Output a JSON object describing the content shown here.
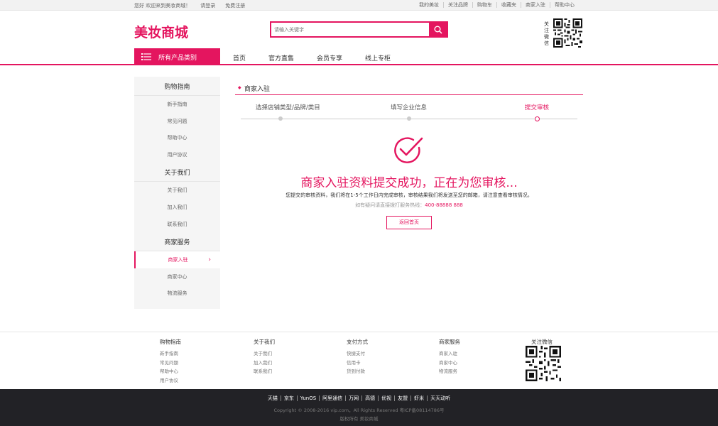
{
  "topbar": {
    "welcome": "您好 欢迎来到美妆商城！",
    "login": "请登录",
    "register": "免费注册",
    "links": [
      "我的美妆",
      "关注品牌",
      "购物车",
      "收藏夹",
      "商家入驻",
      "帮助中心"
    ]
  },
  "header": {
    "logo": "美妆商城",
    "search_placeholder": "请输入关键字",
    "follow_wechat": "关注微信"
  },
  "nav": {
    "all_categories": "所有产品类别",
    "links": [
      "首页",
      "官方直售",
      "会员专享",
      "线上专柜"
    ]
  },
  "sidebar": {
    "sections": [
      {
        "title": "购物指南",
        "items": [
          "新手指南",
          "常见问题",
          "帮助中心",
          "用户协议"
        ]
      },
      {
        "title": "关于我们",
        "items": [
          "关于我们",
          "加入我们",
          "联系我们"
        ]
      },
      {
        "title": "商家服务",
        "items": [
          "商家入驻",
          "商家中心",
          "物流服务"
        ]
      }
    ],
    "active_item": "商家入驻"
  },
  "main": {
    "section_title": "商家入驻",
    "steps": [
      "选择店铺类型/品牌/类目",
      "填写企业信息",
      "提交审核"
    ],
    "current_step": 3,
    "success_title": "商家入驻资料提交成功，正在为您审核...",
    "success_desc": "您提交的审核资料，我们将在1-5个工作日内完成审核，审核结果我们将发送至您的邮箱，请注意查看审核情况。",
    "hotline_label": "如有疑问请直接拨打服务热线：",
    "hotline_number": "400-88888 888",
    "back_button": "返回首页"
  },
  "footer": {
    "columns": [
      {
        "title": "购物指南",
        "items": [
          "新手指南",
          "常见问题",
          "帮助中心",
          "用户协议"
        ]
      },
      {
        "title": "关于我们",
        "items": [
          "关于我们",
          "加入我们",
          "联系我们"
        ]
      },
      {
        "title": "支付方式",
        "items": [
          "快捷支付",
          "信用卡",
          "货到付款"
        ]
      },
      {
        "title": "商家服务",
        "items": [
          "商家入驻",
          "商家中心",
          "物流服务"
        ]
      }
    ],
    "qr_title": "关注微信",
    "partners": [
      "天猫",
      "京东",
      "YunOS",
      "阿里通信",
      "万网",
      "高德",
      "优视",
      "友盟",
      "虾米",
      "天天动听"
    ],
    "copyright": "Copyright © 2008-2016 vip.com，All Rights Reserved 粤ICP备08114786号",
    "rights": "版权所有  美妆商城"
  },
  "colors": {
    "accent": "#e4155f",
    "footer_bg": "#222226",
    "sidebar_bg": "#f5f5f5"
  }
}
